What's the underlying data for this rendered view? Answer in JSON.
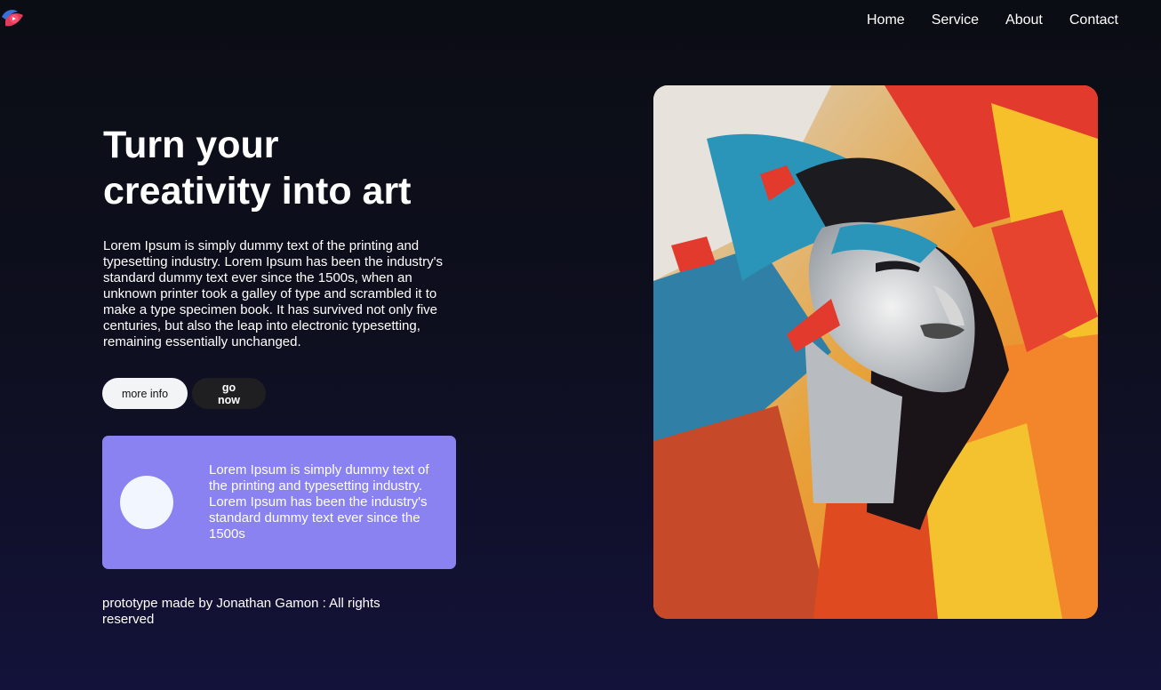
{
  "nav": {
    "items": [
      "Home",
      "Service",
      "About",
      "Contact"
    ]
  },
  "hero": {
    "title_line1": "Turn your",
    "title_line2": "creativity into art",
    "paragraph": "Lorem Ipsum is simply dummy text of the printing and typesetting industry. Lorem Ipsum has been the industry's standard dummy text ever since the 1500s, when an unknown printer took a galley of type and scrambled it to make a type specimen book. It has survived not only five centuries, but also the leap into electronic typesetting, remaining essentially unchanged."
  },
  "buttons": {
    "more_info": "more info",
    "go_now": "go now"
  },
  "card": {
    "text": "Lorem Ipsum is simply dummy text of the printing and typesetting industry. Lorem Ipsum has been the industry's standard dummy text ever since the 1500s"
  },
  "footer": {
    "note": "prototype made by Jonathan Gamon : All rights reserved"
  },
  "icons": {
    "logo": "bird-logo-icon"
  },
  "colors": {
    "background_top": "#0b0d14",
    "background_bottom": "#13123a",
    "card": "#8a82f0",
    "button_light": "#f3f4f6",
    "button_dark": "#1f1f22"
  }
}
